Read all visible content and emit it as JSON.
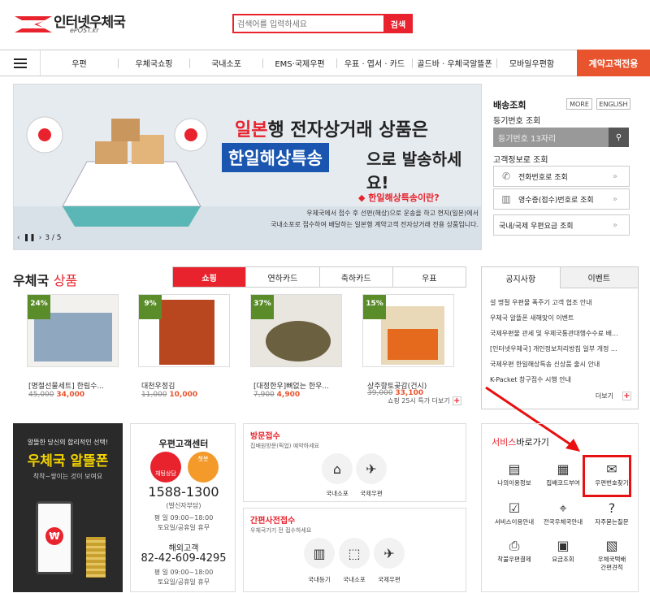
{
  "header": {
    "logo_title": "인터넷우체국",
    "logo_sub": "ePOST.kr",
    "search_placeholder": "검색어를 입력하세요",
    "search_button": "검색"
  },
  "nav": {
    "items": [
      "우편",
      "우체국쇼핑",
      "국내소포",
      "EMS·국제우편",
      "우표 · 엽서 · 카드",
      "골드바 · 우체국알뜰폰",
      "모바일우편함"
    ],
    "highlight": "계약고객전용"
  },
  "banner": {
    "line1_red": "일본",
    "line1": "행 전자상거래 상품은",
    "line2_box": "한일해상특송",
    "line2": "으로 발송하세요!",
    "question": "◆ 한일해상특송이란?",
    "desc1": "우체국에서 접수 후 선편(해상)으로 운송을 하고 현지(일본)에서",
    "desc2": "국내소포로 접수하여 배달하는 일본행 계약고객 전자상거래 전용 상품입니다.",
    "page": "3 / 5"
  },
  "delivery": {
    "title": "배송조회",
    "more_btn": "MORE",
    "english_btn": "ENGLISH",
    "reg_label": "등기번호 조회",
    "reg_placeholder": "등기번호 13자리",
    "info_label": "고객정보로 조회",
    "phone_lookup": "전화번호로 조회",
    "receipt_lookup": "영수증(접수)번호로 조회",
    "fee_lookup": "국내/국제 우편요금 조회"
  },
  "products": {
    "title": "우체국",
    "title_red": "상품",
    "tabs": [
      "쇼핑",
      "연하카드",
      "축하카드",
      "우표"
    ],
    "items": [
      {
        "discount": "24%",
        "name": "[명절선물세트] 한림수...",
        "old": "45,000",
        "price": "34,000"
      },
      {
        "discount": "9%",
        "name": "대천우정김",
        "old": "11,000",
        "price": "10,000"
      },
      {
        "discount": "37%",
        "name": "[대정한우]뼈없는 한우...",
        "old": "7,900",
        "price": "4,900"
      },
      {
        "discount": "15%",
        "name": "상주향토곶감(건시)",
        "old": "39,000",
        "price": "33,100"
      }
    ],
    "more": "쇼핑 25시 특가 더보기"
  },
  "notice": {
    "tabs": [
      "공지사항",
      "이벤트"
    ],
    "items": [
      "설 명절 우편물 폭주기 고객 협조 안내",
      "우체국 알뜰폰 새해맞이 이벤트",
      "국제우편물 관세 및 우체국통관대행수수료 배...",
      "[인터넷우체국] 개인정보처리방침 일부 개정 ...",
      "국제우편 한일해상특송 신상품 출시 안내",
      "K-Packet 창구접수 시행 안내"
    ],
    "more": "더보기"
  },
  "altteul": {
    "line1": "알뜰한 당신의 합리적인 선택!",
    "line2": "우체국 알뜰폰",
    "line3": "착착~쌓이는 것이 보여요"
  },
  "customer_center": {
    "title": "우편고객센터",
    "chat1": "채팅상담",
    "chat2": "챗봇",
    "phone": "1588-1300",
    "phone_note": "(발신자부담)",
    "weekday": "평  일   09:00~18:00",
    "holiday": "토요일/공휴일 휴무",
    "intl_title": "해외고객",
    "intl_phone": "82-42-609-4295",
    "weekday2": "평  일   09:00~18:00",
    "holiday2": "토요일/공휴일 휴무"
  },
  "visit": {
    "title": "방문",
    "title_red": "접수",
    "sub": "집배원방문(픽업) 예약하세요",
    "items": [
      "국내소포",
      "국제우편"
    ]
  },
  "simple": {
    "title": "간편사전",
    "title_red": "접수",
    "sub": "우체국가기 전 접수하세요",
    "items": [
      "국내등기",
      "국내소포",
      "국제우편"
    ]
  },
  "services": {
    "title_red": "서비스",
    "title": "바로가기",
    "items": [
      "나의이용정보",
      "집배코드부여",
      "우편번호찾기",
      "서비스이용안내",
      "전국우체국안내",
      "자주묻는질문",
      "착불우편결제",
      "요금조회",
      "우체국택배\n간편견적"
    ]
  },
  "colors": {
    "accent": "#e8232d",
    "nav_highlight": "#e8542d",
    "discount": "#5a8d2a",
    "alt_yellow": "#f2d200"
  }
}
